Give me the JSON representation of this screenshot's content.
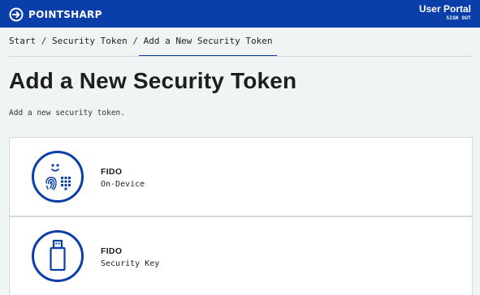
{
  "header": {
    "brand": "POINTSHARP",
    "portal_title": "User Portal",
    "sign_out_label": "SIGN OUT",
    "background_color": "#0a3ea8"
  },
  "breadcrumb": {
    "items": [
      "Start",
      "Security Token",
      "Add a New Security Token"
    ],
    "separator": "/"
  },
  "page": {
    "title": "Add a New Security Token",
    "subtitle": "Add a new security token."
  },
  "tokens": [
    {
      "title": "FIDO",
      "subtitle": "On-Device",
      "icon": "fido-on-device-icon"
    },
    {
      "title": "FIDO",
      "subtitle": "Security Key",
      "icon": "usb-security-key-icon"
    }
  ],
  "colors": {
    "accent": "#0a3ea8",
    "page_background": "#f0f4f5",
    "card_background": "#ffffff"
  }
}
